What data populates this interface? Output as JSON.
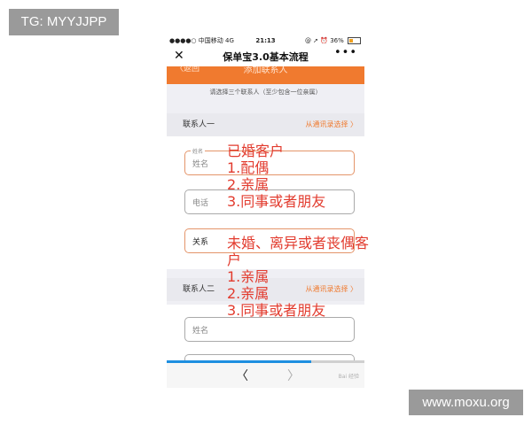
{
  "watermarks": {
    "top_left": "TG: MYYJJPP",
    "bottom_right": "www.moxu.org"
  },
  "status_bar": {
    "carrier": "●●●●○ 中国移动  4G",
    "time": "21:13",
    "right": "@ ➚ ⏰ 36%",
    "battery_level": 0.36,
    "battery_color": "#f0a020"
  },
  "nav": {
    "close": "✕",
    "title": "保单宝3.0基本流程",
    "more": "•••"
  },
  "page_header": {
    "back": "〈返回",
    "title": "添加联系人"
  },
  "hint": "请选择三个联系人（至少包含一位亲属）",
  "contact1": {
    "title": "联系人一",
    "link": "从通讯录选择 〉",
    "name_mini": "姓名",
    "name_label": "姓名",
    "phone_label": "电话",
    "relation_label": "关系"
  },
  "contact2": {
    "title": "联系人二",
    "link": "从通讯录选择 〉",
    "name_label": "姓名"
  },
  "bottom": {
    "back": "〈",
    "forward": "〉",
    "watermark": "Bai 经验"
  },
  "annotations": {
    "married": [
      "已婚客户",
      "1.配偶",
      "2.亲属",
      "3.同事或者朋友"
    ],
    "unmarried": [
      "未婚、离异或者丧偶客",
      "户",
      "1.亲属",
      "2.亲属",
      "3.同事或者朋友"
    ]
  },
  "colors": {
    "accent": "#f07a2f",
    "annotation": "#e23b2e",
    "progress": "#1e8fe0"
  },
  "progress": 0.73
}
